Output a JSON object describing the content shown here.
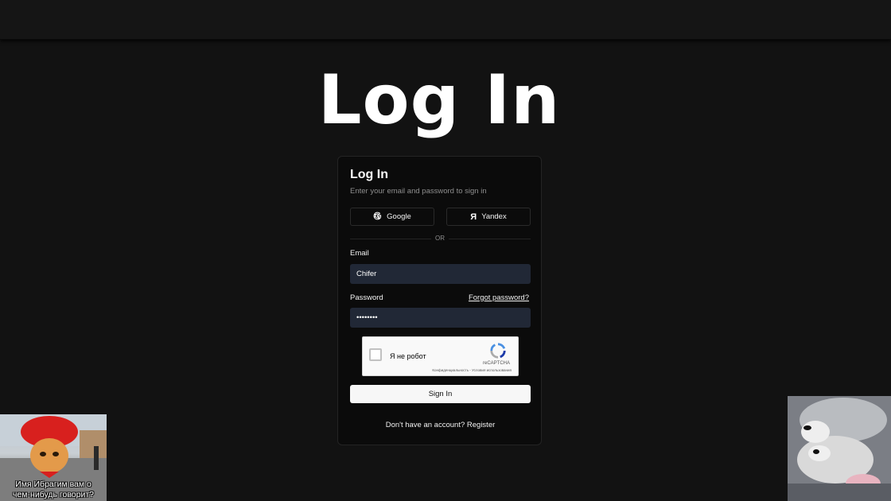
{
  "hero": {
    "title": "Log In"
  },
  "card": {
    "title": "Log In",
    "subtitle": "Enter your email and password to sign in",
    "oauth": {
      "google": {
        "label": "Google",
        "icon": "google-icon"
      },
      "yandex": {
        "label": "Yandex",
        "icon": "yandex-icon",
        "glyph": "Я"
      }
    },
    "divider_text": "OR",
    "email": {
      "label": "Email",
      "value": "Chifer"
    },
    "password": {
      "label": "Password",
      "value": "••••••••",
      "forgot_label": "Forgot password?"
    },
    "captcha": {
      "label": "Я не робот",
      "brand": "reCAPTCHA",
      "terms": "Конфиденциальность - Условия использования"
    },
    "signin_label": "Sign In",
    "register": {
      "prompt": "Don't have an account?",
      "link": "Register"
    }
  },
  "memes": {
    "left_caption_line1": "Имя Ибрагим вам о",
    "left_caption_line2": "чем-нибудь говорит?"
  },
  "colors": {
    "background": "#121212",
    "card": "#0b0b0b",
    "input": "#212836",
    "primary_button": "#f7f7f7"
  }
}
